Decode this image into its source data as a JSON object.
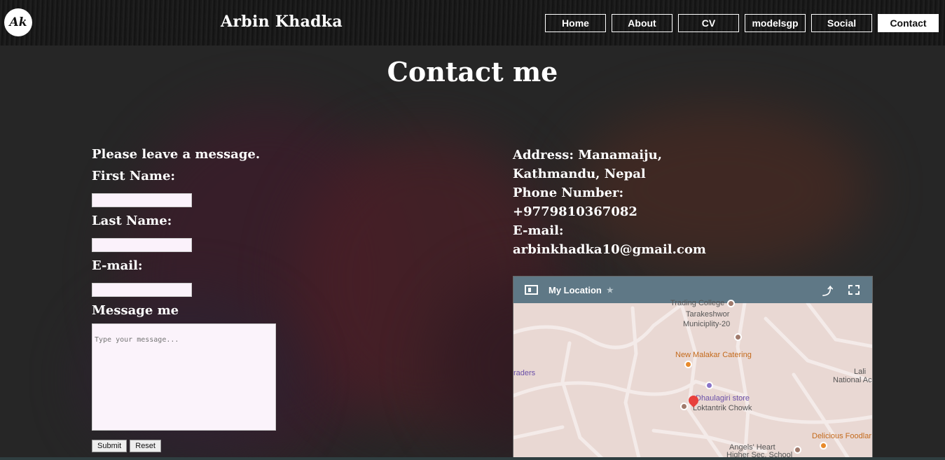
{
  "header": {
    "logo_text": "Ak",
    "site_title": "Arbin Khadka",
    "nav": [
      {
        "label": "Home"
      },
      {
        "label": "About"
      },
      {
        "label": "CV"
      },
      {
        "label": "modelsgp"
      },
      {
        "label": "Social"
      },
      {
        "label": "Contact",
        "active": true
      }
    ]
  },
  "page": {
    "title": "Contact me"
  },
  "form": {
    "intro": "Please leave a message.",
    "first_name_label": "First Name:",
    "first_name_value": "",
    "last_name_label": "Last Name:",
    "last_name_value": "",
    "email_label": "E-mail:",
    "email_value": "",
    "message_label": "Message me",
    "message_placeholder": "Type your message...",
    "submit_label": "Submit",
    "reset_label": "Reset"
  },
  "contact": {
    "line1": "Address: Manamaiju,",
    "line2": "Kathmandu, Nepal",
    "line3": "Phone Number:",
    "line4": "+9779810367082",
    "line5": "E-mail:",
    "line6": "arbinkhadka10@gmail.com"
  },
  "map": {
    "title": "My Location",
    "star": "★",
    "share": "⤴",
    "labels": {
      "college": "Trading College",
      "tarakeshwor": "Tarakeshwor",
      "municipality": "Municiplity-20",
      "catering": "New Malakar Catering",
      "traders": "raders",
      "lali": "Lali",
      "national": "National Ac",
      "store": "Dhaulagiri store",
      "chowk": "Loktantrik Chowk",
      "delicious": "Delicious Foodlar",
      "angels": "Angels' Heart",
      "school": "Higher Sec. School"
    }
  }
}
